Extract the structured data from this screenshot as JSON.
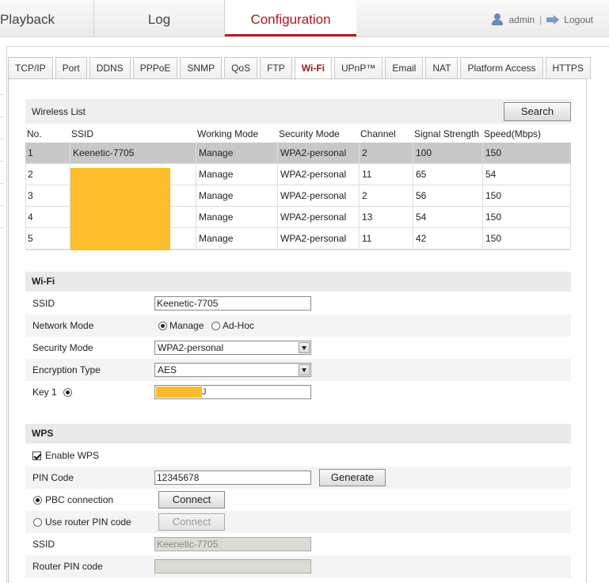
{
  "topnav": {
    "playback": "Playback",
    "log": "Log",
    "configuration": "Configuration",
    "user": "admin",
    "separator": "|",
    "logout": "Logout"
  },
  "tabs": [
    {
      "label": "TCP/IP"
    },
    {
      "label": "Port"
    },
    {
      "label": "DDNS"
    },
    {
      "label": "PPPoE"
    },
    {
      "label": "SNMP"
    },
    {
      "label": "QoS"
    },
    {
      "label": "FTP"
    },
    {
      "label": "Wi-Fi",
      "active": true
    },
    {
      "label": "UPnP™"
    },
    {
      "label": "Email"
    },
    {
      "label": "NAT"
    },
    {
      "label": "Platform Access"
    },
    {
      "label": "HTTPS"
    }
  ],
  "wireless_list": {
    "title": "Wireless List",
    "search_label": "Search",
    "columns": [
      "No.",
      "SSID",
      "Working Mode",
      "Security Mode",
      "Channel",
      "Signal Strength",
      "Speed(Mbps)"
    ],
    "rows": [
      {
        "no": "1",
        "ssid": "Keenetic-7705",
        "mode": "Manage",
        "security": "WPA2-personal",
        "channel": "2",
        "signal": "100",
        "speed": "150"
      },
      {
        "no": "2",
        "ssid": "",
        "mode": "Manage",
        "security": "WPA2-personal",
        "channel": "11",
        "signal": "65",
        "speed": "54"
      },
      {
        "no": "3",
        "ssid": "",
        "mode": "Manage",
        "security": "WPA2-personal",
        "channel": "2",
        "signal": "56",
        "speed": "150"
      },
      {
        "no": "4",
        "ssid": "",
        "mode": "Manage",
        "security": "WPA2-personal",
        "channel": "13",
        "signal": "54",
        "speed": "150"
      },
      {
        "no": "5",
        "ssid": "",
        "mode": "Manage",
        "security": "WPA2-personal",
        "channel": "11",
        "signal": "42",
        "speed": "150"
      }
    ]
  },
  "wifi": {
    "title": "Wi-Fi",
    "ssid_label": "SSID",
    "ssid_value": "Keenetic-7705",
    "network_mode_label": "Network Mode",
    "mode_manage": "Manage",
    "mode_adhoc": "Ad-Hoc",
    "security_mode_label": "Security Mode",
    "security_mode_value": "WPA2-personal",
    "encryption_label": "Encryption Type",
    "encryption_value": "AES",
    "key1_label": "Key 1",
    "key1_tail": "J"
  },
  "wps": {
    "title": "WPS",
    "enable_label": "Enable WPS",
    "pin_label": "PIN Code",
    "pin_value": "12345678",
    "generate_label": "Generate",
    "pbc_label": "PBC connection",
    "connect_label": "Connect",
    "router_pin_label": "Use router PIN code",
    "connect2_label": "Connect",
    "ssid_label": "SSID",
    "ssid_value": "Keenetic-7705",
    "router_pin_code_label": "Router PIN code",
    "router_pin_code_value": ""
  },
  "colors": {
    "accent": "#c5181e",
    "redaction": "#fbbd2b",
    "selected_row": "#c8c8c8"
  }
}
